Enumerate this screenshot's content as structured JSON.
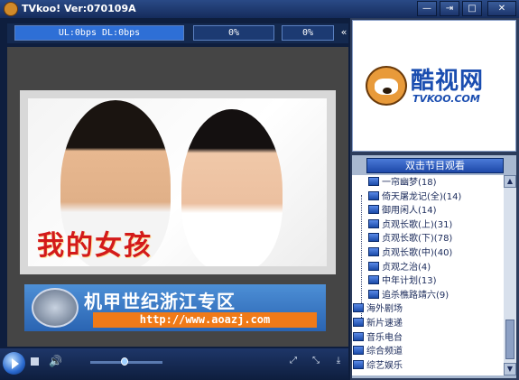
{
  "titlebar": {
    "title": "TVkoo! Ver:070109A",
    "minimize_glyph": "—",
    "pin_glyph": "⇥",
    "restore_glyph": "□",
    "close_glyph": "✕"
  },
  "stats": {
    "rates": "UL:0bps  DL:0bps",
    "progress_a": "0%",
    "progress_b": "0%",
    "collapse_glyph": "«"
  },
  "poster": {
    "title_text": "我的女孩"
  },
  "banner": {
    "title": "机甲世纪浙江专区",
    "url": "http://www.aoazj.com"
  },
  "logo": {
    "name_cn": "酷视网",
    "name_en": "TVKOO.COM"
  },
  "player": {
    "volume_level": 0.42,
    "volume_glyph": "🔊",
    "fullscreen_glyph": "⤢",
    "shrink_glyph": "⤡",
    "mini_glyph": "⤓"
  },
  "channel_list": {
    "header": "双击节目观看",
    "items": [
      {
        "label": "一帘幽梦(18)",
        "type": "program"
      },
      {
        "label": "倚天屠龙记(全)(14)",
        "type": "program"
      },
      {
        "label": "御用闲人(14)",
        "type": "program"
      },
      {
        "label": "贞观长歌(上)(31)",
        "type": "program"
      },
      {
        "label": "贞观长歌(下)(78)",
        "type": "program"
      },
      {
        "label": "贞观长歌(中)(40)",
        "type": "program"
      },
      {
        "label": "贞观之治(4)",
        "type": "program"
      },
      {
        "label": "中年计划(13)",
        "type": "program"
      },
      {
        "label": "追杀樵路靖六(9)",
        "type": "program"
      },
      {
        "label": "海外剧场",
        "type": "category"
      },
      {
        "label": "新片速递",
        "type": "category"
      },
      {
        "label": "音乐电台",
        "type": "category"
      },
      {
        "label": "综合频道",
        "type": "category"
      },
      {
        "label": "综艺娱乐",
        "type": "category"
      }
    ]
  },
  "scrollbar": {
    "up_glyph": "▲",
    "down_glyph": "▼"
  },
  "colors": {
    "accent": "#1e48a8",
    "panel": "#2c3c5c",
    "banner_orange": "#f07a18"
  }
}
